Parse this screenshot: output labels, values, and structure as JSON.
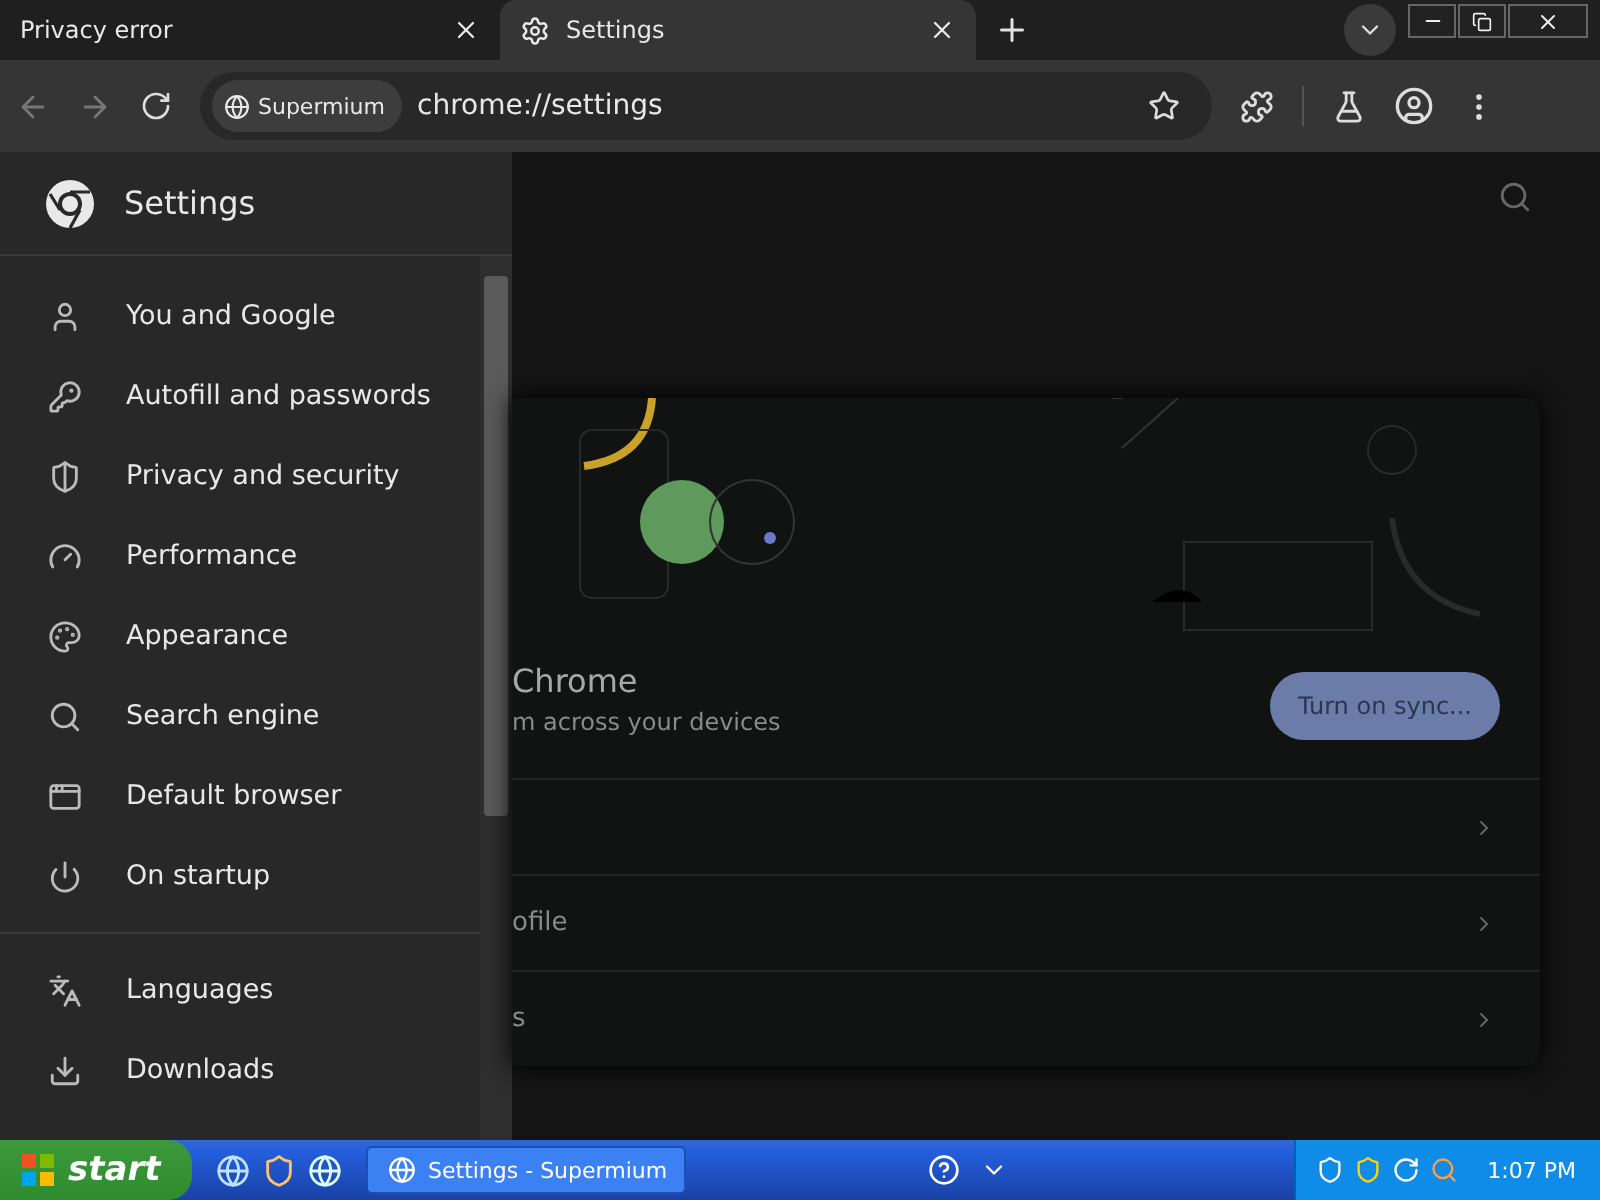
{
  "tabs": [
    {
      "label": "Privacy error",
      "selected": false
    },
    {
      "label": "Settings",
      "selected": true
    }
  ],
  "address": {
    "chip": "Supermium",
    "url": "chrome://settings"
  },
  "sidebar": {
    "title": "Settings",
    "groups": [
      [
        {
          "label": "You and Google",
          "kind": "person"
        },
        {
          "label": "Autofill and passwords",
          "kind": "key"
        },
        {
          "label": "Privacy and security",
          "kind": "shield"
        },
        {
          "label": "Performance",
          "kind": "gauge"
        },
        {
          "label": "Appearance",
          "kind": "palette"
        },
        {
          "label": "Search engine",
          "kind": "search"
        },
        {
          "label": "Default browser",
          "kind": "window"
        },
        {
          "label": "On startup",
          "kind": "power"
        }
      ],
      [
        {
          "label": "Languages",
          "kind": "languages"
        },
        {
          "label": "Downloads",
          "kind": "download"
        }
      ]
    ]
  },
  "card": {
    "title": "Chrome",
    "subtitle": "m across your devices",
    "button": "Turn on sync...",
    "rows": [
      "",
      "ofile",
      "s"
    ]
  },
  "taskbar": {
    "start": "start",
    "task": "Settings - Supermium",
    "clock": "1:07 PM"
  }
}
